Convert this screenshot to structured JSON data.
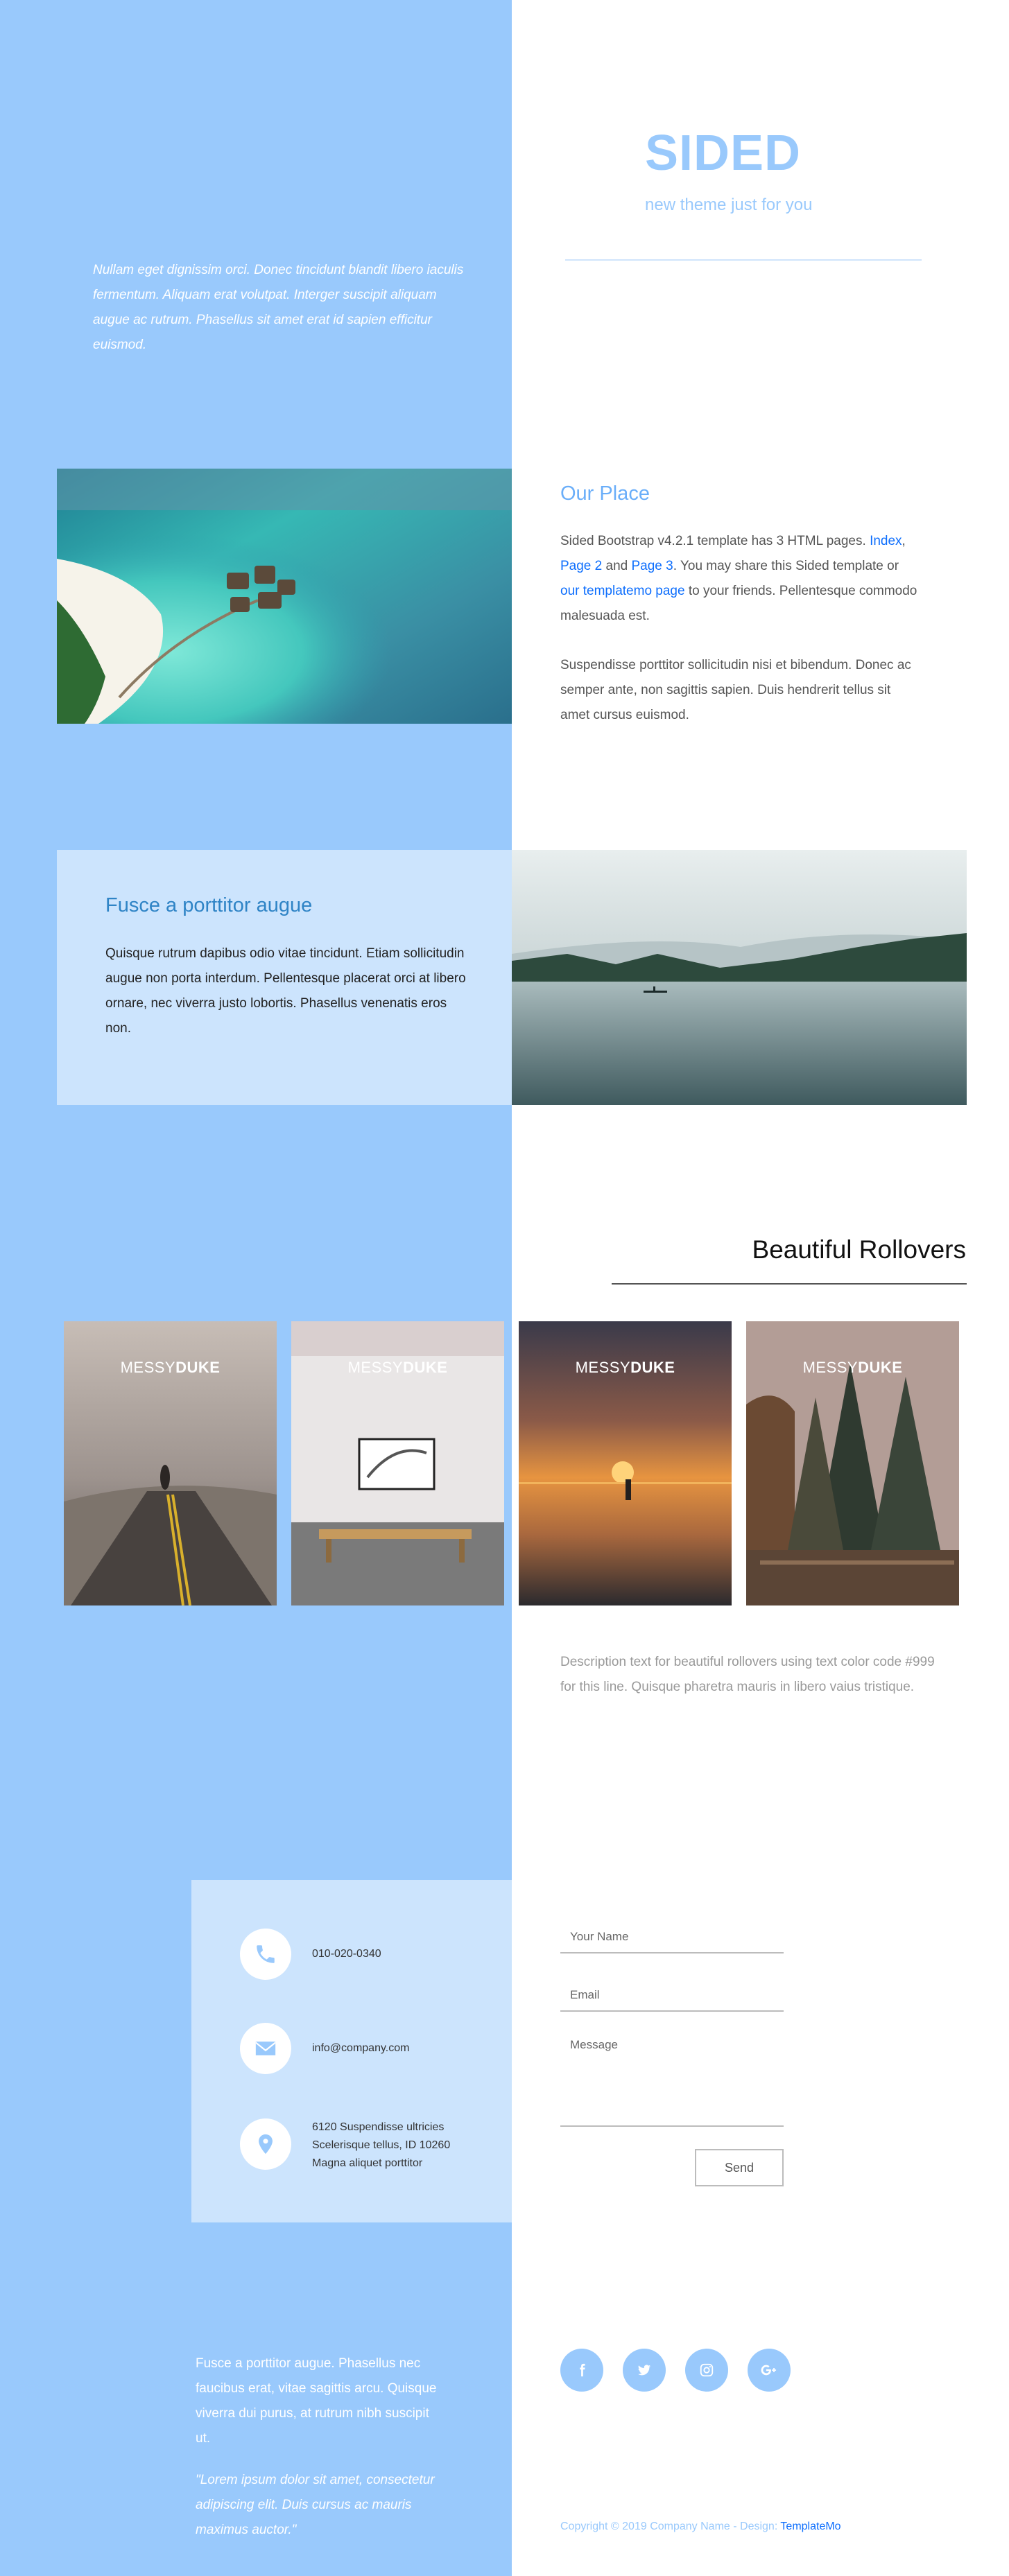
{
  "hero": {
    "text": "Nullam eget dignissim orci. Donec tincidunt blandit libero iaculis fermentum. Aliquam erat volutpat. Interger suscipit aliquam augue ac rutrum. Phasellus sit amet erat id sapien efficitur euismod.",
    "brand_title": "SIDED",
    "brand_tagline": "new theme just for you"
  },
  "place": {
    "title": "Our Place",
    "p1_intro": "Sided Bootstrap v4.2.1 template has 3 HTML pages.",
    "link_index": "Index",
    "comma": ",",
    "link_page2": "Page 2",
    "and": "and",
    "link_page3": "Page 3",
    "p1_mid": ". You may share this Sided template or",
    "link_templatemo": "our templatemo page",
    "p1_end": "to your friends. Pellentesque commodo malesuada est.",
    "p2": "Suspendisse porttitor sollicitudin nisi et bibendum. Donec ac semper ante, non sagittis sapien. Duis hendrerit tellus sit amet cursus euismod."
  },
  "fusce": {
    "title": "Fusce a porttitor augue",
    "text": "Quisque rutrum dapibus odio vitae tincidunt. Etiam sollicitudin augue non porta interdum. Pellentesque placerat orci at libero ornare, nec viverra justo lobortis. Phasellus venenatis eros non."
  },
  "rollovers": {
    "title": "Beautiful Rollovers",
    "logo_light": "MESSY",
    "logo_bold": "DUKE",
    "description": "Description text for beautiful rollovers using text color code #999 for this line. Quisque pharetra mauris in libero vaius tristique."
  },
  "contact": {
    "phone": "010-020-0340",
    "email": "info@company.com",
    "address_line1": "6120 Suspendisse ultricies",
    "address_line2": "Scelerisque tellus, ID 10260",
    "address_line3": "Magna aliquet porttitor",
    "name_placeholder": "Your Name",
    "email_placeholder": "Email",
    "message_placeholder": "Message",
    "send_label": "Send"
  },
  "footer": {
    "text": "Fusce a porttitor augue. Phasellus nec faucibus erat, vitae sagittis arcu. Quisque viverra dui purus, at rutrum nibh suscipit ut.",
    "quote": "\"Lorem ipsum dolor sit amet, consectetur adipiscing elit. Duis cursus ac mauris maximus auctor.\"",
    "copyright": "Copyright © 2019 Company Name - Design:",
    "design_link": "TemplateMo"
  },
  "colors": {
    "accent": "#99c9fc",
    "panel": "#cce4fd",
    "link": "#0d6efd"
  },
  "icons": {
    "phone": "phone-icon",
    "envelope": "envelope-icon",
    "location": "map-marker-icon",
    "facebook": "facebook-icon",
    "twitter": "twitter-icon",
    "instagram": "instagram-icon",
    "google_plus": "google-plus-icon"
  }
}
